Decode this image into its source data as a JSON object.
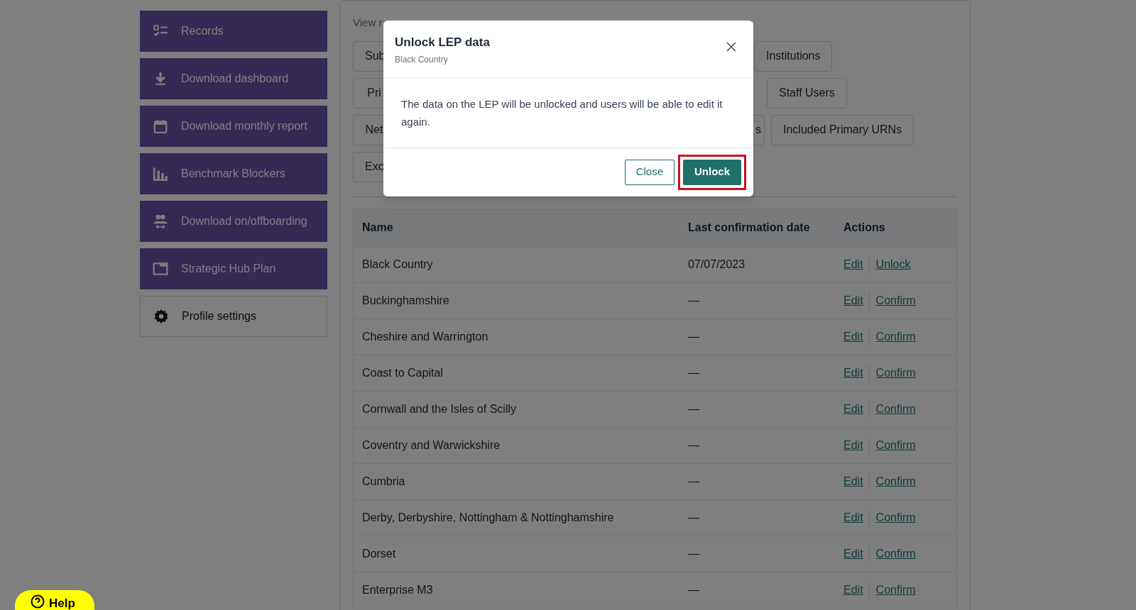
{
  "sidebar": {
    "items": [
      {
        "label": "Records",
        "kind": "primary"
      },
      {
        "label": "Download dashboard",
        "kind": "primary"
      },
      {
        "label": "Download monthly report",
        "kind": "primary"
      },
      {
        "label": "Benchmark Blockers",
        "kind": "primary"
      },
      {
        "label": "Download on/offboarding",
        "kind": "primary"
      },
      {
        "label": "Strategic Hub Plan",
        "kind": "primary"
      },
      {
        "label": "Profile settings",
        "kind": "secondary"
      }
    ]
  },
  "filters": {
    "label": "View r",
    "rows": [
      {
        "left": "Sub",
        "right": [
          "Institutions"
        ]
      },
      {
        "left": "Pri",
        "right": [
          "Staff Users"
        ]
      },
      {
        "left": "Net",
        "right": [
          "s",
          "Included Primary URNs"
        ]
      },
      {
        "left": "Exc",
        "right": []
      }
    ]
  },
  "table": {
    "columns": [
      "Name",
      "Last confirmation date",
      "Actions"
    ],
    "rows": [
      {
        "name": "Black Country",
        "date": "07/07/2023",
        "actions": [
          "Edit",
          "Unlock"
        ]
      },
      {
        "name": "Buckinghamshire",
        "date": "—",
        "actions": [
          "Edit",
          "Confirm"
        ]
      },
      {
        "name": "Cheshire and Warrington",
        "date": "—",
        "actions": [
          "Edit",
          "Confirm"
        ]
      },
      {
        "name": "Coast to Capital",
        "date": "—",
        "actions": [
          "Edit",
          "Confirm"
        ]
      },
      {
        "name": "Cornwall and the Isles of Scilly",
        "date": "—",
        "actions": [
          "Edit",
          "Confirm"
        ]
      },
      {
        "name": "Coventry and Warwickshire",
        "date": "—",
        "actions": [
          "Edit",
          "Confirm"
        ]
      },
      {
        "name": "Cumbria",
        "date": "—",
        "actions": [
          "Edit",
          "Confirm"
        ]
      },
      {
        "name": "Derby, Derbyshire, Nottingham & Nottinghamshire",
        "date": "—",
        "actions": [
          "Edit",
          "Confirm"
        ]
      },
      {
        "name": "Dorset",
        "date": "—",
        "actions": [
          "Edit",
          "Confirm"
        ]
      },
      {
        "name": "Enterprise M3",
        "date": "—",
        "actions": [
          "Edit",
          "Confirm"
        ]
      }
    ]
  },
  "help_button": {
    "label": "Help"
  },
  "modal": {
    "title": "Unlock LEP data",
    "subtitle": "Black Country",
    "body": "The data on the LEP will be unlocked and users will be able to edit it again.",
    "buttons": [
      {
        "label": "Close",
        "kind": "secondary",
        "highlighted": false
      },
      {
        "label": "Unlock",
        "kind": "primary",
        "highlighted": true
      }
    ]
  }
}
